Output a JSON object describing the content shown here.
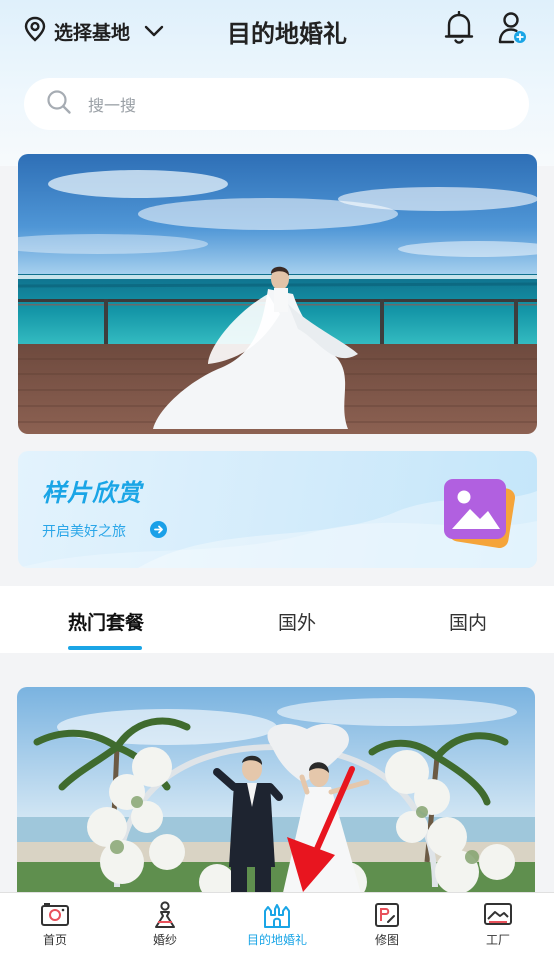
{
  "header": {
    "location_label": "选择基地",
    "title": "目的地婚礼"
  },
  "search": {
    "placeholder": "搜一搜"
  },
  "sample_card": {
    "title": "样片欣赏",
    "subtitle": "开启美好之旅"
  },
  "tabs": [
    {
      "label": "热门套餐",
      "active": true
    },
    {
      "label": "国外",
      "active": false
    },
    {
      "label": "国内",
      "active": false
    }
  ],
  "bottom_nav": [
    {
      "label": "首页",
      "icon": "camera-icon",
      "active": false
    },
    {
      "label": "婚纱",
      "icon": "bride-icon",
      "active": false
    },
    {
      "label": "目的地婚礼",
      "icon": "castle-icon",
      "active": true
    },
    {
      "label": "修图",
      "icon": "retouch-icon",
      "active": false
    },
    {
      "label": "工厂",
      "icon": "photo-frame-icon",
      "active": false
    }
  ],
  "colors": {
    "accent": "#1aa5e6",
    "header_bg": "#e3f2fc",
    "annotation_arrow": "#e8151f"
  }
}
